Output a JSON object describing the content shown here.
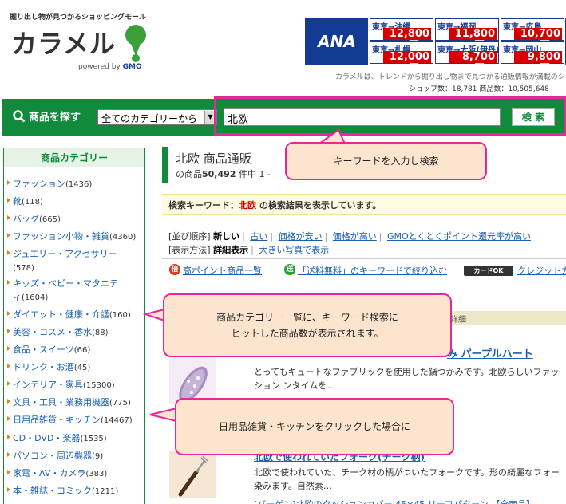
{
  "header": {
    "tagline": "掘り出し物が見つかるショッピングモール",
    "logo_text": "カラメル",
    "powered_by": "powered by",
    "powered_brand": "GMO",
    "description": "カラメルは、トレンドから掘り出し物まで見つかる通販情報が満載のシ",
    "stats": "ショップ数：18,781  商品数：10,505,648"
  },
  "banner": {
    "logo": "ANA",
    "fares": [
      {
        "route": "東京→沖縄",
        "price": "12,800円〜"
      },
      {
        "route": "東京→福岡",
        "price": "11,800円〜"
      },
      {
        "route": "東京→広島",
        "price": "10,700円〜"
      },
      {
        "route": "東京→札幌",
        "price": "12,000円〜"
      },
      {
        "route": "東京→大阪(伊丹)",
        "price": "8,700円〜"
      },
      {
        "route": "東京→岡山",
        "price": "9,800円〜"
      }
    ]
  },
  "search": {
    "label": "商品を探す",
    "category_value": "全てのカテゴリーから",
    "query": "北欧",
    "button": "検 索"
  },
  "sidebar": {
    "title": "商品カテゴリー",
    "items": [
      {
        "label": "ファッション",
        "count": "(1436)"
      },
      {
        "label": "靴",
        "count": "(118)"
      },
      {
        "label": "バッグ",
        "count": "(665)"
      },
      {
        "label": "ファッション小物・雑貨",
        "count": "(4360)"
      },
      {
        "label": "ジュエリー・アクセサリー",
        "count": "(578)"
      },
      {
        "label": "キッズ・ベビー・マタニティ",
        "count": "(1604)"
      },
      {
        "label": "ダイエット・健康・介護",
        "count": "(160)"
      },
      {
        "label": "美容・コスメ・香水",
        "count": "(88)"
      },
      {
        "label": "食品・スイーツ",
        "count": "(66)"
      },
      {
        "label": "ドリンク・お酒",
        "count": "(45)"
      },
      {
        "label": "インテリア・家具",
        "count": "(15300)"
      },
      {
        "label": "文具・工具・業務用機器",
        "count": "(775)"
      },
      {
        "label": "日用品雑貨・キッチン",
        "count": "(14467)"
      },
      {
        "label": "CD・DVD・楽器",
        "count": "(1535)"
      },
      {
        "label": "パソコン・周辺機器",
        "count": "(9)"
      },
      {
        "label": "家電・AV・カメラ",
        "count": "(383)"
      },
      {
        "label": "本・雑誌・コミック",
        "count": "(1211)"
      }
    ]
  },
  "main": {
    "title": "北欧 商品通販",
    "count_prefix": "の商品",
    "count": "50,492",
    "count_suffix": "件中 1 -",
    "kw_prefix": "検索キーワード：",
    "kw_value": "北欧",
    "kw_suffix": " の検索結果を表示しています。",
    "sort_label": "[並び順序]",
    "sort_options": [
      "新しい",
      "古い",
      "価格が安い",
      "価格が高い",
      "GMOとくとくポイント還元率が高い"
    ],
    "display_label": "[表示方法]",
    "display_options": [
      "詳細表示",
      "大きい写真で表示"
    ],
    "promos": [
      "高ポイント商品一覧",
      "「送料無料」のキーワードで絞り込む",
      "クレジットカ"
    ],
    "promo_icons": [
      "倍",
      "送"
    ],
    "card_badge": "カードOK",
    "detail_label": "詳細",
    "products": [
      {
        "title": "み パープルハート",
        "desc": "とってもキュートなファブリックを使用した鍋つかみです。北欧らしいファッション ンタイムを…"
      },
      {
        "title": "北欧で使われていたフォーク(チーク柄)",
        "desc": "北欧で使われていた、チーク材の柄がついたフォークです。形の綺麗なフォー 染みます。自然素…"
      },
      {
        "title": "[バーゲン]北欧のクッションカバー 45×45 リーフパターン 【全商品】"
      }
    ]
  },
  "callouts": [
    "キーワードを入力し検索",
    "商品カテゴリー一覧に、キーワード検索に\nヒットした商品数が表示されます。",
    "日用品雑貨・キッチンをクリックした場合に"
  ],
  "colors": {
    "brand_green": "#128a3c",
    "highlight_pink": "#e8279a",
    "callout_bg": "#fde4cf",
    "link_blue": "#1a5fb0",
    "price_red": "#d40000"
  }
}
